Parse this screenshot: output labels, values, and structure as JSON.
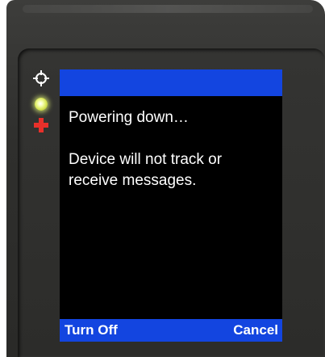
{
  "screen": {
    "title": "",
    "message": {
      "line1": "Powering down…",
      "line2": "Device will not track or receive messages."
    },
    "softkeys": {
      "left_label": "Turn Off",
      "right_label": "Cancel"
    }
  },
  "indicators": [
    {
      "name": "gps-icon",
      "color": "#ffffff"
    },
    {
      "name": "status-led",
      "color": "#e8f870"
    },
    {
      "name": "sos-plus-icon",
      "color": "#e8302a"
    }
  ],
  "colors": {
    "accent_blue": "#1345e0",
    "screen_bg": "#000000",
    "housing": "#2f2f2d"
  }
}
